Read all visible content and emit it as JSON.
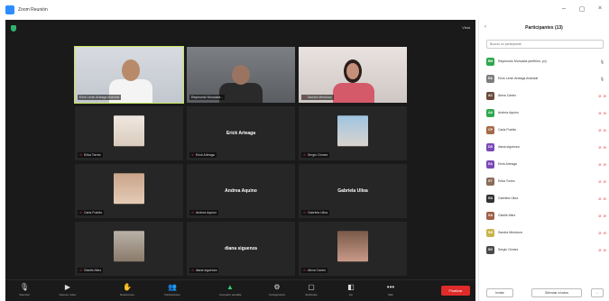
{
  "window": {
    "title": "Zoom Reunión",
    "controls": [
      "–",
      "▢",
      "×"
    ]
  },
  "meeting": {
    "view_label": "Vista",
    "tiles": [
      {
        "type": "video",
        "name": "Erick Lenin Arteaga Andrade",
        "muted": false,
        "active": true
      },
      {
        "type": "video",
        "name": "Raymundo Moncada...",
        "muted": false,
        "active": false
      },
      {
        "type": "video",
        "name": "Sandra Mendoza",
        "muted": true,
        "active": false
      },
      {
        "type": "photo",
        "name": "Erika Torres",
        "muted": true
      },
      {
        "type": "name",
        "name": "Erick Arteaga",
        "display": "Erick Arteaga",
        "muted": true
      },
      {
        "type": "photo",
        "name": "Sergio Gómez",
        "muted": true
      },
      {
        "type": "photo",
        "name": "Carla Pueblo",
        "muted": true
      },
      {
        "type": "name",
        "name": "Andrea Aquino",
        "display": "Andrea Aquino",
        "muted": true
      },
      {
        "type": "name",
        "name": "Gabriela Ulloa",
        "display": "Gabriela Ulloa",
        "muted": true
      },
      {
        "type": "photo",
        "name": "Giselle Altez",
        "muted": true
      },
      {
        "type": "name",
        "name": "diana siguenza",
        "display": "diana siguenza",
        "muted": true
      },
      {
        "type": "photo",
        "name": "Alexa Castro",
        "muted": true
      }
    ]
  },
  "toolbar": {
    "items": [
      {
        "icon": "🎙",
        "label": "Silenciar"
      },
      {
        "icon": "▶",
        "label": "Detener video"
      },
      {
        "icon": "✋",
        "label": "Reacciones"
      },
      {
        "icon": "👥",
        "label": "Participantes"
      },
      {
        "icon": "▲",
        "label": "Compartir pantalla"
      },
      {
        "icon": "⚙",
        "label": "Configuración"
      },
      {
        "icon": "▢",
        "label": "Subtítulos"
      },
      {
        "icon": "◧",
        "label": "Ver"
      },
      {
        "icon": "•••",
        "label": "Más"
      }
    ],
    "end_label": "Finalizar"
  },
  "participants": {
    "title": "Participantes (13)",
    "search_placeholder": "Buscar un participante",
    "list": [
      {
        "name": "Raymundo Moncada (anfitrión, yo)",
        "initials": "RM",
        "color": "#2fa84f"
      },
      {
        "name": "Erick Lenin Arteaga Andrade",
        "initials": "EA",
        "color": "#7e7e7e"
      },
      {
        "name": "Alexa Castro",
        "initials": "AC",
        "color": "#6a4a3a"
      },
      {
        "name": "Andrea Aquino",
        "initials": "AA",
        "color": "#2fa84f"
      },
      {
        "name": "Carla Pueblo",
        "initials": "CP",
        "color": "#a56a4a"
      },
      {
        "name": "diana siguenza",
        "initials": "DS",
        "color": "#7a4ab6"
      },
      {
        "name": "Erick Arteaga",
        "initials": "EA",
        "color": "#7a4ab6"
      },
      {
        "name": "Erika Torres",
        "initials": "ET",
        "color": "#8a6a5a"
      },
      {
        "name": "Gabriela Ulloa",
        "initials": "GU",
        "color": "#333333"
      },
      {
        "name": "Giselle Altez",
        "initials": "GA",
        "color": "#a06048"
      },
      {
        "name": "Sandra Mendoza",
        "initials": "SM",
        "color": "#c9b44a"
      },
      {
        "name": "Sergio Gómez",
        "initials": "SG",
        "color": "#4a4a4a"
      }
    ],
    "invite_label": "Invitar",
    "mute_all_label": "Silenciar a todos",
    "more_label": "..."
  }
}
